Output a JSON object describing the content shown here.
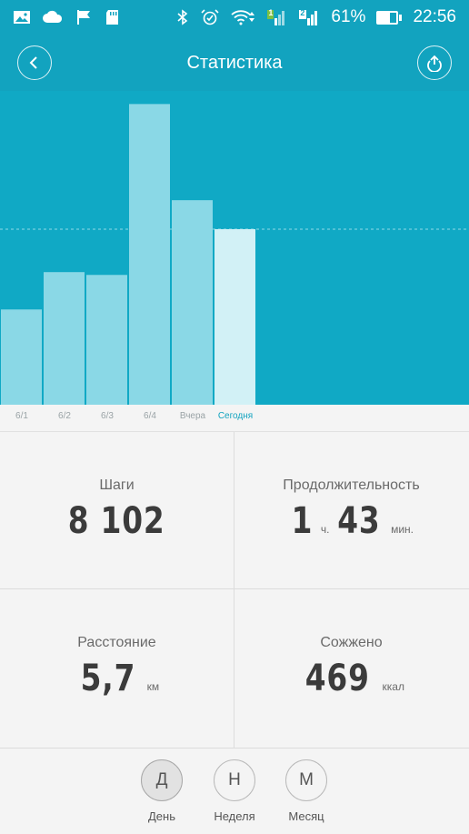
{
  "status_bar": {
    "battery_percent": "61%",
    "time": "22:56",
    "sim1_label": "1",
    "sim2_label": "2",
    "battery_level": 0.61,
    "left_icons": [
      "image-icon",
      "cloud-icon",
      "flag-icon",
      "sd-card-icon"
    ],
    "right_icons": [
      "bluetooth-icon",
      "alarm-icon",
      "wifi-icon",
      "signal-sim1-icon",
      "signal-sim2-icon",
      "battery-icon"
    ]
  },
  "header": {
    "title": "Статистика",
    "back_icon": "chevron-left-icon",
    "share_icon": "upload-icon"
  },
  "chart_data": {
    "type": "bar",
    "categories": [
      "6/1",
      "6/2",
      "6/3",
      "6/4",
      "Вчера",
      "Сегодня"
    ],
    "values": [
      5100,
      7100,
      6950,
      16100,
      10950,
      9400
    ],
    "ylim": [
      0,
      16800
    ],
    "goal_line": 9400,
    "highlighted_category": "Сегодня",
    "colors": {
      "background": "#10a9c5",
      "bar": "#8ad8e6",
      "bar_today": "#d2f1f6",
      "goal_line": "#8fd9e7"
    }
  },
  "stats": {
    "steps": {
      "label": "Шаги",
      "value": "8 102"
    },
    "duration": {
      "label": "Продолжительность",
      "hours": "1",
      "hours_unit": "ч.",
      "minutes": "43",
      "minutes_unit": "мин."
    },
    "distance": {
      "label": "Расстояние",
      "value": "5,7",
      "unit": "км"
    },
    "burned": {
      "label": "Сожжено",
      "value": "469",
      "unit": "ккал"
    }
  },
  "tabs": [
    {
      "letter": "Д",
      "label": "День",
      "active": true
    },
    {
      "letter": "Н",
      "label": "Неделя",
      "active": false
    },
    {
      "letter": "М",
      "label": "Месяц",
      "active": false
    }
  ],
  "colors": {
    "accent": "#12a3bf"
  }
}
